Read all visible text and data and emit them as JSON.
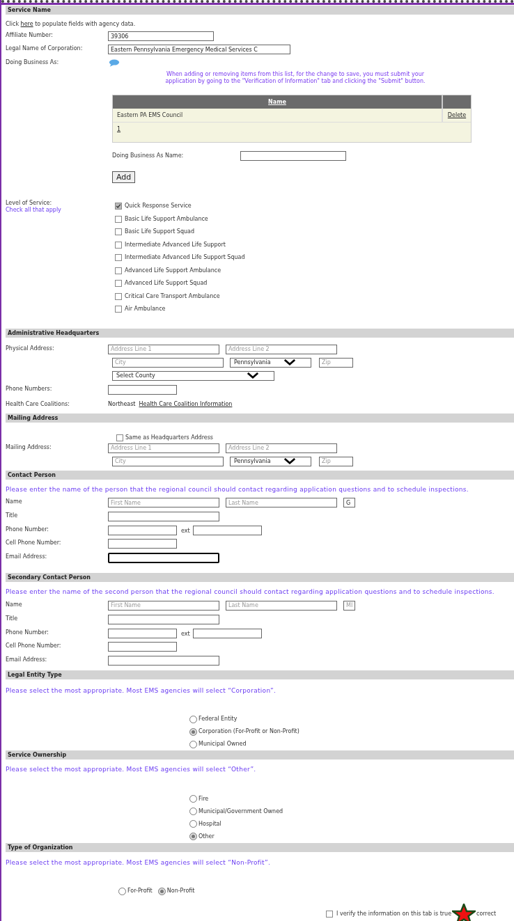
{
  "service_name": {
    "heading": "Service Name",
    "intro": {
      "before": "Click",
      "link": "here",
      "after": "to populate fields with agency data."
    },
    "affiliate_number": {
      "label": "Affiliate Number:",
      "value": "39306"
    },
    "legal_name": {
      "label": "Legal Name of Corporation:",
      "value": "Eastern Pennsylvania Emergency Medical Services C"
    },
    "dba": {
      "label": "Doing Business As:",
      "notice": "When adding or removing items from this list, for the change to save, you must submit your application by going to the \"Verification of Information\" tab and clicking the \"Submit\" button.",
      "table": {
        "columns": [
          "Name"
        ],
        "rows": [
          {
            "name": "Eastern PA EMS Council",
            "action": "Delete"
          }
        ],
        "pages": [
          "1"
        ]
      },
      "name_field": {
        "label": "Doing Business As Name:"
      },
      "add_button": "Add"
    }
  },
  "level_of_service": {
    "label": "Level of Service:",
    "hint": "Check all that apply",
    "options": [
      {
        "label": "Quick Response Service",
        "checked": true
      },
      {
        "label": "Basic Life Support Ambulance",
        "checked": false
      },
      {
        "label": "Basic Life Support Squad",
        "checked": false
      },
      {
        "label": "Intermediate Advanced Life Support",
        "checked": false
      },
      {
        "label": "Intermediate Advanced Life Support Squad",
        "checked": false
      },
      {
        "label": "Advanced Life Support Ambulance",
        "checked": false
      },
      {
        "label": "Advanced Life Support Squad",
        "checked": false
      },
      {
        "label": "Critical Care Transport Ambulance",
        "checked": false
      },
      {
        "label": "Air Ambulance",
        "checked": false
      }
    ]
  },
  "headquarters": {
    "heading": "Administrative Headquarters",
    "physical_address": {
      "label": "Physical Address:",
      "line1": {
        "placeholder": "Address Line 1"
      },
      "line2": {
        "placeholder": "Address Line 2"
      },
      "city": {
        "placeholder": "City"
      },
      "state": "Pennsylvania",
      "zip": {
        "placeholder": "Zip"
      },
      "county": "Select County"
    },
    "phone": {
      "label": "Phone Numbers:"
    },
    "coalitions": {
      "label": "Health Care Coalitions:",
      "region": "Northeast",
      "link": "Health Care Coalition Information"
    }
  },
  "mailing": {
    "heading": "Mailing Address",
    "same_as": {
      "label": "Same as Headquarters Address",
      "checked": false
    },
    "address": {
      "label": "Mailing Address:",
      "line1": {
        "placeholder": "Address Line 1"
      },
      "line2": {
        "placeholder": "Address Line 2"
      },
      "city": {
        "placeholder": "City"
      },
      "state": "Pennsylvania",
      "zip": {
        "placeholder": "Zip"
      }
    }
  },
  "contact": {
    "heading": "Contact Person",
    "note": "Please enter the name of the person that the regional council should contact regarding application questions and to schedule inspections.",
    "name": {
      "label": "Name",
      "first": {
        "placeholder": "First Name"
      },
      "last": {
        "placeholder": "Last Name"
      },
      "middle": {
        "value": "G"
      }
    },
    "title": {
      "label": "Title"
    },
    "phone": {
      "label": "Phone Number:",
      "ext": "ext"
    },
    "cell": {
      "label": "Cell Phone Number:"
    },
    "email": {
      "label": "Email Address:",
      "focused": true
    }
  },
  "secondary_contact": {
    "heading": "Secondary Contact Person",
    "note": "Please enter the name of the second person that the regional council should contact regarding application questions and to schedule inspections.",
    "name": {
      "label": "Name",
      "first": {
        "placeholder": "First Name"
      },
      "last": {
        "placeholder": "Last Name"
      },
      "middle": {
        "placeholder": "MI"
      }
    },
    "title": {
      "label": "Title"
    },
    "phone": {
      "label": "Phone Number:",
      "ext": "ext"
    },
    "cell": {
      "label": "Cell Phone Number:"
    },
    "email": {
      "label": "Email Address:",
      "focused": false
    }
  },
  "legal_entity": {
    "heading": "Legal Entity Type",
    "note": "Please select the most appropriate. Most EMS agencies will select “Corporation”.",
    "options": [
      {
        "label": "Federal Entity",
        "selected": false
      },
      {
        "label": "Corporation (For-Profit or Non-Profit)",
        "selected": true
      },
      {
        "label": "Municipal Owned",
        "selected": false
      }
    ]
  },
  "ownership": {
    "heading": "Service Ownership",
    "note": "Please select the most appropriate. Most EMS agencies will select “Other”.",
    "options": [
      {
        "label": "Fire",
        "selected": false
      },
      {
        "label": "Municipal/Government Owned",
        "selected": false
      },
      {
        "label": "Hospital",
        "selected": false
      },
      {
        "label": "Other",
        "selected": true
      }
    ]
  },
  "organization": {
    "heading": "Type of Organization",
    "note": "Please select the most appropriate. Most EMS agencies will select “Non-Profit”.",
    "options": [
      {
        "label": "For-Profit",
        "selected": false
      },
      {
        "label": "Non-Profit",
        "selected": true
      }
    ]
  },
  "verify": {
    "before": "I verify the information on this tab is true",
    "after": "correct",
    "checked": false
  }
}
